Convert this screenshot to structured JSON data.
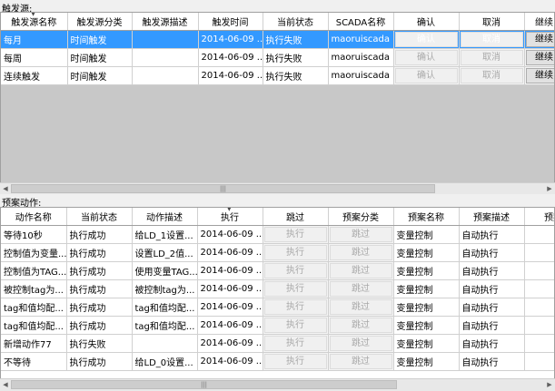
{
  "trigger_section_label": "触发源:",
  "trigger_columns": [
    "触发源名称",
    "触发源分类",
    "触发源描述",
    "触发时间",
    "当前状态",
    "SCADA名称",
    "确认",
    "取消",
    "继续"
  ],
  "trigger_rows": [
    {
      "name": "每月",
      "category": "时间触发",
      "desc": "",
      "time": "2014-06-09 ...",
      "status": "执行失败",
      "scada": "maoruiscada",
      "confirm": "确认",
      "cancel": "取消",
      "continue": "继续"
    },
    {
      "name": "每周",
      "category": "时间触发",
      "desc": "",
      "time": "2014-06-09 ...",
      "status": "执行失败",
      "scada": "maoruiscada",
      "confirm": "确认",
      "cancel": "取消",
      "continue": "继续"
    },
    {
      "name": "连续触发",
      "category": "时间触发",
      "desc": "",
      "time": "2014-06-09 ...",
      "status": "执行失败",
      "scada": "maoruiscada",
      "confirm": "确认",
      "cancel": "取消",
      "continue": "继续"
    }
  ],
  "action_section_label": "预案动作:",
  "action_columns": [
    "动作名称",
    "当前状态",
    "动作描述",
    "执行",
    "跳过",
    "预案分类",
    "预案名称",
    "预案描述",
    "预案"
  ],
  "action_rows": [
    {
      "name": "等待10秒",
      "status": "执行成功",
      "desc": "给LD_1设置...",
      "time": "2014-06-09 ...",
      "exec": "执行",
      "skip": "跳过",
      "category": "变量控制",
      "plan": "自动执行",
      "plan_desc": ""
    },
    {
      "name": "控制值为变量...",
      "status": "执行成功",
      "desc": "设置LD_2值...",
      "time": "2014-06-09 ...",
      "exec": "执行",
      "skip": "跳过",
      "category": "变量控制",
      "plan": "自动执行",
      "plan_desc": ""
    },
    {
      "name": "控制值为TAG...",
      "status": "执行成功",
      "desc": "使用变量TAG...",
      "time": "2014-06-09 ...",
      "exec": "执行",
      "skip": "跳过",
      "category": "变量控制",
      "plan": "自动执行",
      "plan_desc": ""
    },
    {
      "name": "被控制tag为...",
      "status": "执行成功",
      "desc": "被控制tag为...",
      "time": "2014-06-09 ...",
      "exec": "执行",
      "skip": "跳过",
      "category": "变量控制",
      "plan": "自动执行",
      "plan_desc": ""
    },
    {
      "name": "tag和值均配...",
      "status": "执行成功",
      "desc": "tag和值均配...",
      "time": "2014-06-09 ...",
      "exec": "执行",
      "skip": "跳过",
      "category": "变量控制",
      "plan": "自动执行",
      "plan_desc": ""
    },
    {
      "name": "tag和值均配...",
      "status": "执行成功",
      "desc": "tag和值均配...",
      "time": "2014-06-09 ...",
      "exec": "执行",
      "skip": "跳过",
      "category": "变量控制",
      "plan": "自动执行",
      "plan_desc": ""
    },
    {
      "name": "新增动作77",
      "status": "执行失败",
      "desc": "",
      "time": "2014-06-09 ...",
      "exec": "执行",
      "skip": "跳过",
      "category": "变量控制",
      "plan": "自动执行",
      "plan_desc": ""
    },
    {
      "name": "不等待",
      "status": "执行成功",
      "desc": "给LD_0设置...",
      "time": "2014-06-09 ...",
      "exec": "执行",
      "skip": "跳过",
      "category": "变量控制",
      "plan": "自动执行",
      "plan_desc": ""
    }
  ],
  "scroll_left_icon": "chevron-left-icon",
  "scroll_right_icon": "chevron-right-icon",
  "sort_icon": "sort-down-icon"
}
